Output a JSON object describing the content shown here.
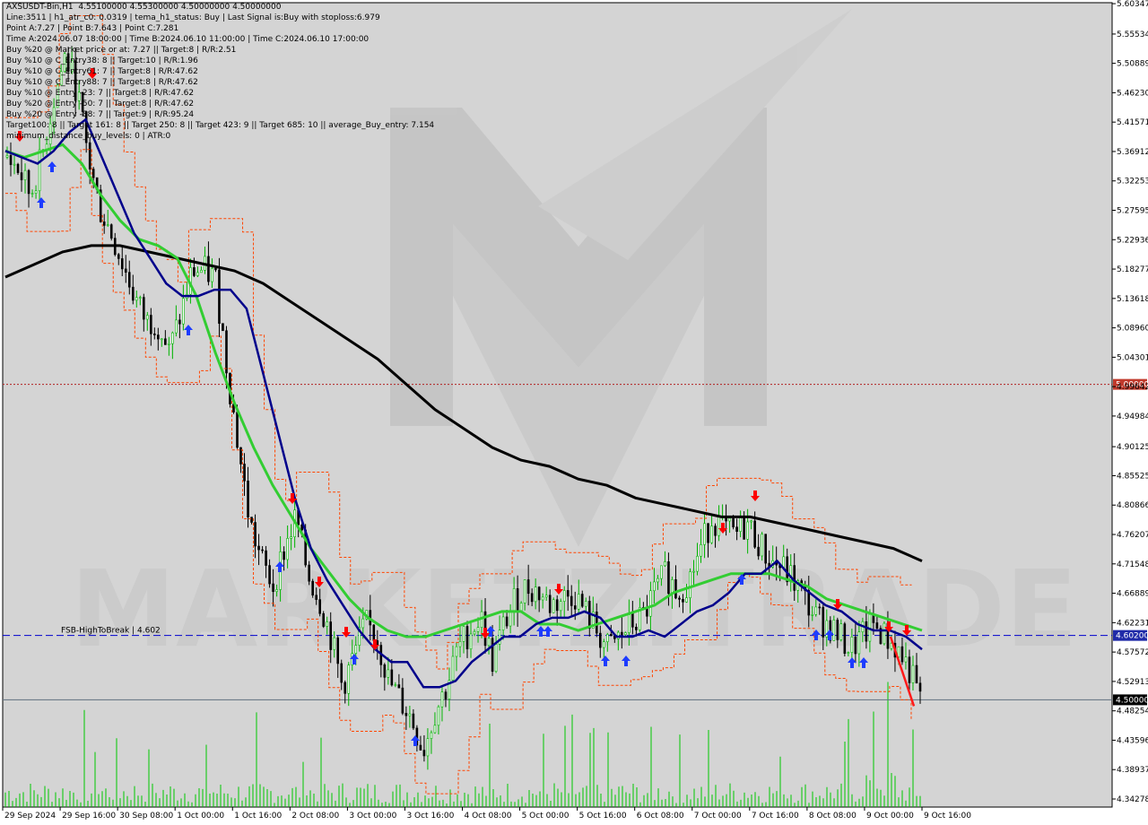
{
  "colors": {
    "bull_candle": "#00b400",
    "bear_candle": "#000000",
    "ma_fast": "#00008b",
    "ma_mid": "#32cd32",
    "ma_slow": "#000000",
    "envelope": "#ff4500",
    "volume": "#00c800",
    "buy_arrow": "#1e3cff",
    "sell_arrow": "#ff0000",
    "level_red": "#b22222",
    "level_blue": "#0000cd",
    "level_grey": "#607080",
    "watermark": "#c8c8c8"
  },
  "header": {
    "lines": [
      "AXSUSDT-Bin,H1  4.55100000 4.55300000 4.50000000 4.50000000",
      "Line:3511 | h1_atr_c0: 0.0319 | tema_h1_status: Buy | Last Signal is:Buy with stoploss:6.979",
      "Point A:7.27 | Point B:7.643 | Point C:7.281",
      "Time A:2024.06.07 18:00:00 | Time B:2024.06.10 11:00:00 | Time C:2024.06.10 17:00:00",
      "Buy %20 @ Market price or at: 7.27 || Target:8 | R/R:2.51",
      "Buy %10 @ C_Entry38: 8 || Target:10 | R/R:1.96",
      "Buy %10 @ C_Entry61: 7 || Target:8 | R/R:47.62",
      "Buy %10 @ C_Entry88: 7 || Target:8 | R/R:47.62",
      "Buy %10 @ Entry -23: 7 || Target:8 | R/R:47.62",
      "Buy %20 @ Entry -50: 7 || Target:8 | R/R:47.62",
      "Buy %20 @ Entry -88: 7 || Target:9 | R/R:95.24",
      "Target100: 8 || Target 161: 8 || Target 250: 8 || Target 423: 9 || Target 685: 10 || average_Buy_entry: 7.154",
      "minimum_distance_buy_levels: 0 | ATR:0"
    ]
  },
  "watermark_text": "MARKETZITRADE",
  "fsb_label": "FSB-HighToBreak | 4.602",
  "chart_data": {
    "type": "candlestick",
    "symbol": "AXSUSDT-Bin",
    "timeframe": "H1",
    "ohlc_last": {
      "open": 4.551,
      "high": 4.553,
      "low": 4.5,
      "close": 4.5
    },
    "ylim": [
      4.33,
      5.605
    ],
    "y_ticks": [
      "5.60347",
      "5.55534",
      "5.50889",
      "5.46230",
      "5.41571",
      "5.36912",
      "5.32253",
      "5.27595",
      "5.22936",
      "5.18277",
      "5.13618",
      "5.08960",
      "5.04301",
      "4.99642",
      "4.94984",
      "4.90125",
      "4.85525",
      "4.80866",
      "4.76207",
      "4.71548",
      "4.66889",
      "4.62231",
      "4.57572",
      "4.52913",
      "4.48254",
      "4.43596",
      "4.38937",
      "4.34278"
    ],
    "x_ticks": [
      "29 Sep 2024",
      "29 Sep 16:00",
      "30 Sep 08:00",
      "1 Oct 00:00",
      "1 Oct 16:00",
      "2 Oct 08:00",
      "3 Oct 00:00",
      "3 Oct 16:00",
      "4 Oct 08:00",
      "5 Oct 00:00",
      "5 Oct 16:00",
      "6 Oct 08:00",
      "7 Oct 00:00",
      "7 Oct 16:00",
      "8 Oct 08:00",
      "9 Oct 00:00",
      "9 Oct 16:00"
    ],
    "close_path": [
      5.36,
      5.34,
      5.3,
      5.36,
      5.45,
      5.52,
      5.47,
      5.36,
      5.28,
      5.24,
      5.19,
      5.14,
      5.1,
      5.1,
      5.05,
      5.11,
      5.18,
      5.18,
      5.17,
      5.03,
      4.9,
      4.78,
      4.72,
      4.68,
      4.74,
      4.79,
      4.7,
      4.66,
      4.6,
      4.52,
      4.57,
      4.62,
      4.6,
      4.53,
      4.5,
      4.47,
      4.42,
      4.48,
      4.52,
      4.58,
      4.61,
      4.63,
      4.56,
      4.62,
      4.66,
      4.68,
      4.67,
      4.65,
      4.66,
      4.67,
      4.64,
      4.61,
      4.58,
      4.6,
      4.62,
      4.63,
      4.67,
      4.7,
      4.67,
      4.69,
      4.74,
      4.79,
      4.77,
      4.76,
      4.78,
      4.75,
      4.72,
      4.71,
      4.69,
      4.66,
      4.63,
      4.62,
      4.6,
      4.58,
      4.6,
      4.62,
      4.6,
      4.58,
      4.55,
      4.5
    ],
    "ma_fast": [
      5.37,
      5.36,
      5.35,
      5.37,
      5.4,
      5.42,
      5.36,
      5.3,
      5.24,
      5.2,
      5.16,
      5.14,
      5.14,
      5.15,
      5.15,
      5.12,
      5.02,
      4.92,
      4.82,
      4.74,
      4.69,
      4.65,
      4.61,
      4.58,
      4.56,
      4.56,
      4.52,
      4.52,
      4.53,
      4.56,
      4.58,
      4.6,
      4.6,
      4.62,
      4.63,
      4.63,
      4.64,
      4.63,
      4.6,
      4.6,
      4.61,
      4.6,
      4.62,
      4.64,
      4.65,
      4.67,
      4.7,
      4.7,
      4.72,
      4.69,
      4.67,
      4.65,
      4.64,
      4.62,
      4.61,
      4.61,
      4.6,
      4.58
    ],
    "ma_mid": [
      5.37,
      5.36,
      5.37,
      5.38,
      5.35,
      5.3,
      5.26,
      5.23,
      5.22,
      5.2,
      5.14,
      5.05,
      4.97,
      4.9,
      4.84,
      4.79,
      4.74,
      4.7,
      4.66,
      4.63,
      4.61,
      4.6,
      4.6,
      4.61,
      4.62,
      4.63,
      4.64,
      4.64,
      4.62,
      4.62,
      4.61,
      4.62,
      4.63,
      4.64,
      4.65,
      4.67,
      4.68,
      4.69,
      4.7,
      4.7,
      4.7,
      4.69,
      4.68,
      4.66,
      4.65,
      4.64,
      4.63,
      4.62,
      4.61
    ],
    "ma_slow": [
      5.17,
      5.19,
      5.21,
      5.22,
      5.22,
      5.21,
      5.2,
      5.19,
      5.18,
      5.16,
      5.13,
      5.1,
      5.07,
      5.04,
      5.0,
      4.96,
      4.93,
      4.9,
      4.88,
      4.87,
      4.85,
      4.84,
      4.82,
      4.81,
      4.8,
      4.79,
      4.79,
      4.78,
      4.77,
      4.76,
      4.75,
      4.74,
      4.72
    ],
    "horizontal_levels": [
      {
        "label": "5.00000",
        "value": 5.0
      },
      {
        "label": "4.60200",
        "value": 4.602
      },
      {
        "label": "4.50000",
        "value": 4.5
      }
    ]
  }
}
